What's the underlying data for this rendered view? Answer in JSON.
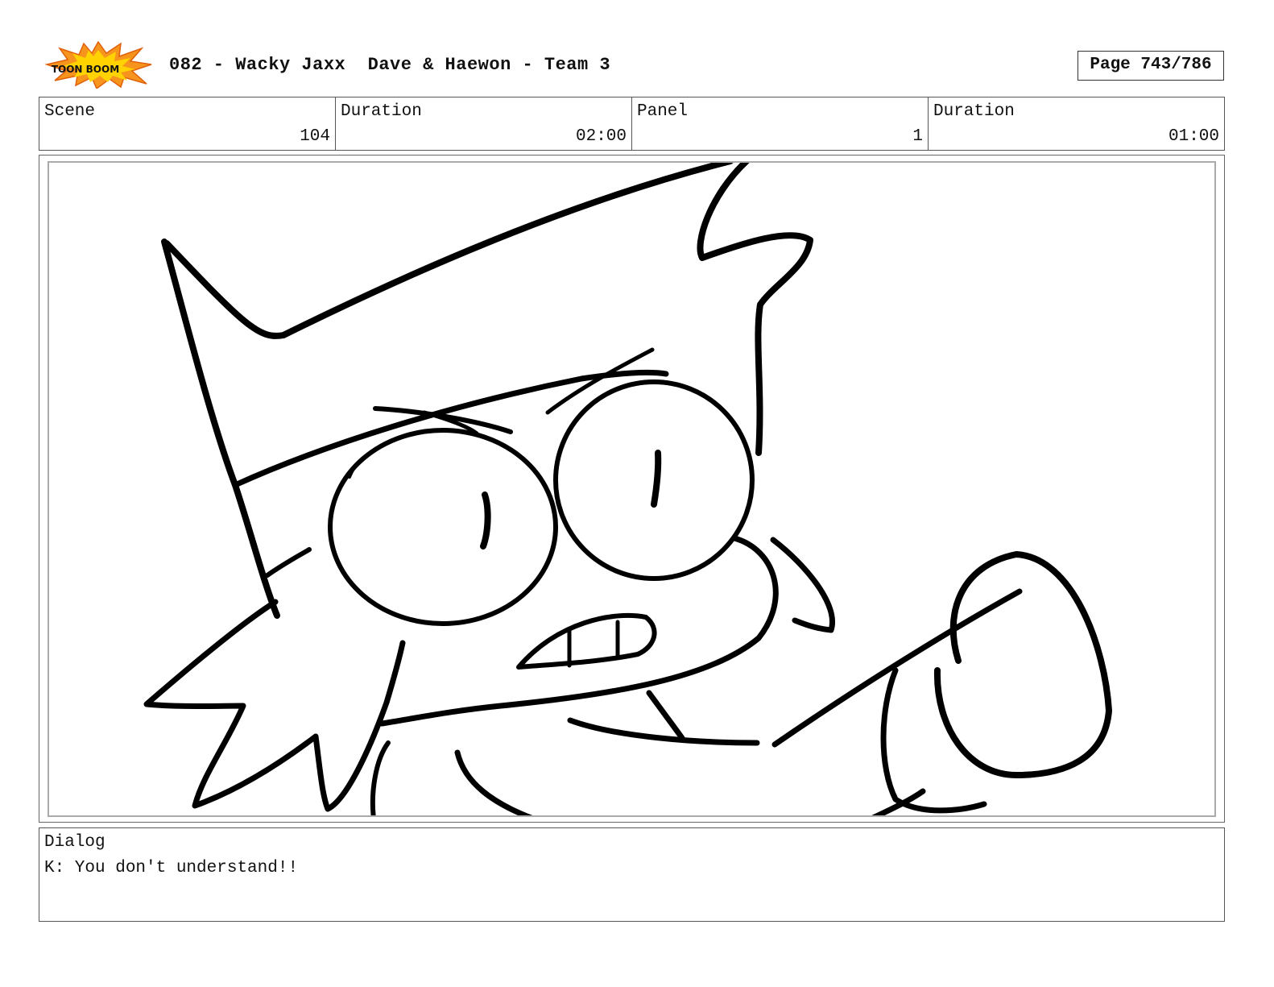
{
  "header": {
    "logo_text": "TOON BOOM",
    "title": "082 - Wacky Jaxx  Dave & Haewon - Team 3",
    "page": "Page 743/786"
  },
  "info": {
    "scene_label": "Scene",
    "scene_value": "104",
    "scene_duration_label": "Duration",
    "scene_duration_value": "02:00",
    "panel_label": "Panel",
    "panel_value": "1",
    "panel_duration_label": "Duration",
    "panel_duration_value": "01:00"
  },
  "dialog": {
    "label": "Dialog",
    "text": "K: You don't understand!!"
  },
  "colors": {
    "logo_orange": "#f7941d",
    "logo_yellow": "#ffd200",
    "ink": "#000000"
  }
}
